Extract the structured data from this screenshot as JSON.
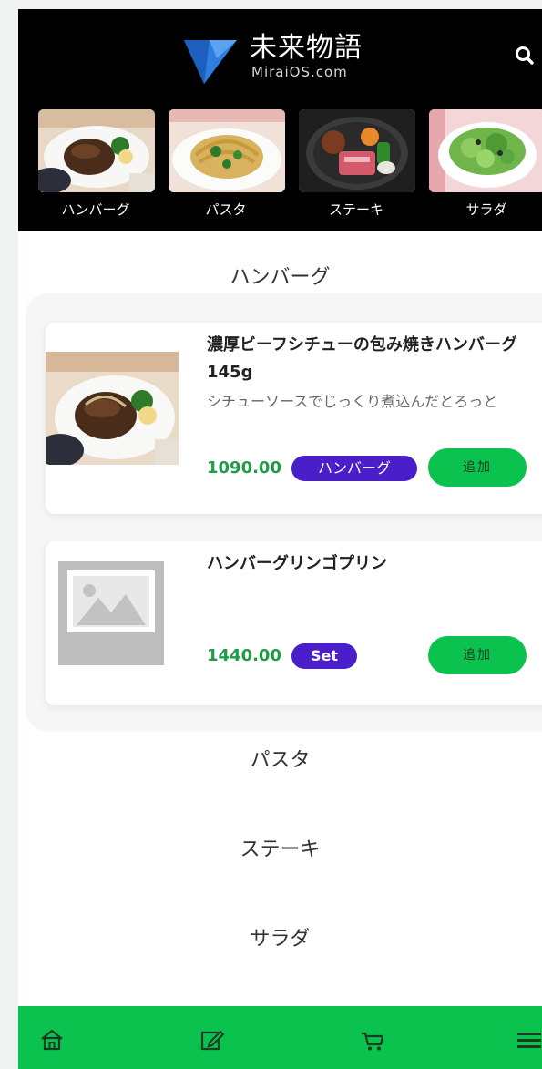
{
  "header": {
    "brand_name": "未来物語",
    "brand_sub": "MiraiOS.com"
  },
  "categories": [
    {
      "label": "ハンバーグ",
      "image": "hamburger-steak-photo"
    },
    {
      "label": "パスタ",
      "image": "pasta-photo"
    },
    {
      "label": "ステーキ",
      "image": "steak-photo"
    },
    {
      "label": "サラダ",
      "image": "salad-photo"
    }
  ],
  "sections": [
    {
      "title": "ハンバーグ"
    },
    {
      "title": "パスタ"
    },
    {
      "title": "ステーキ"
    },
    {
      "title": "サラダ"
    }
  ],
  "products": [
    {
      "name": "濃厚ビーフシチューの包み焼きハンバーグ 145g",
      "description": "シチューソースでじっくり煮込んだとろっと",
      "price": "1090.00",
      "tag": "ハンバーグ",
      "add_label": "追加",
      "image": "hamburger-steak-photo"
    },
    {
      "name": "ハンバーグリンゴプリン",
      "description": "",
      "price": "1440.00",
      "tag": "Set",
      "add_label": "追加",
      "image": "placeholder-image-icon"
    }
  ],
  "bottom_nav": [
    {
      "icon": "home-icon"
    },
    {
      "icon": "edit-icon"
    },
    {
      "icon": "cart-icon"
    },
    {
      "icon": "menu-icon"
    }
  ],
  "colors": {
    "header_bg": "#000000",
    "accent_green": "#0cc24e",
    "price_green": "#1f9c46",
    "tag_purple": "#4a1ec8",
    "logo_blue": "#2f7de1"
  }
}
